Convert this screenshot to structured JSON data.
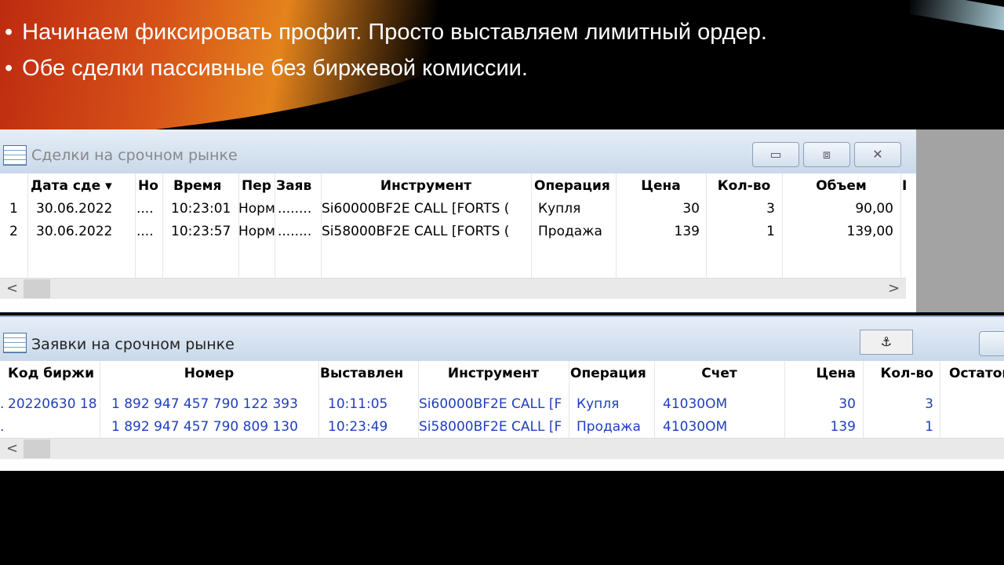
{
  "slide": {
    "bullets": [
      "Начинаем фиксировать профит. Просто выставляем лимитный ордер.",
      "Обе сделки пассивные без биржевой комиссии."
    ]
  },
  "deals": {
    "title": "Сделки на срочном рынке",
    "buttons": {
      "minimize": "▭",
      "restore": "⧈",
      "close": "✕"
    },
    "columns": [
      "",
      "Дата сде ▾",
      "Но",
      "Время",
      "Пер",
      "Заяв",
      "Инструмент",
      "Операция",
      "Цена",
      "Кол-во",
      "Объем",
      "I"
    ],
    "rows": [
      [
        "1",
        "30.06.2022",
        "....",
        "10:23:01",
        "Норм",
        "........",
        "Si60000BF2E CALL [FORTS (",
        "Купля",
        "30",
        "3",
        "90,00"
      ],
      [
        "2",
        "30.06.2022",
        "....",
        "10:23:57",
        "Норм",
        "........",
        "Si58000BF2E CALL [FORTS (",
        "Продажа",
        "139",
        "1",
        "139,00"
      ]
    ],
    "scroll": {
      "left": "<",
      "right": ">"
    }
  },
  "orders": {
    "title": "Заявки на срочном рынке",
    "anchor": "⚓",
    "columns": [
      "Код биржи",
      "Номер",
      "Выставлен",
      "Инструмент",
      "Операция",
      "Счет",
      "Цена",
      "Кол-во",
      "Остаток"
    ],
    "rows": [
      [
        ".",
        "20220630 18",
        "1 892 947 457 790 122 393",
        "10:11:05",
        "Si60000BF2E CALL [F",
        "Купля",
        "41030OM",
        "30",
        "3"
      ],
      [
        ".",
        "",
        "1 892 947 457 790 809 130",
        "10:23:49",
        "Si58000BF2E CALL [F",
        "Продажа",
        "41030OM",
        "139",
        "1"
      ]
    ],
    "scroll": {
      "left": "<"
    }
  },
  "colors": {
    "order_text": "#1f3fbf",
    "titlebar": "#c9d9ea"
  }
}
